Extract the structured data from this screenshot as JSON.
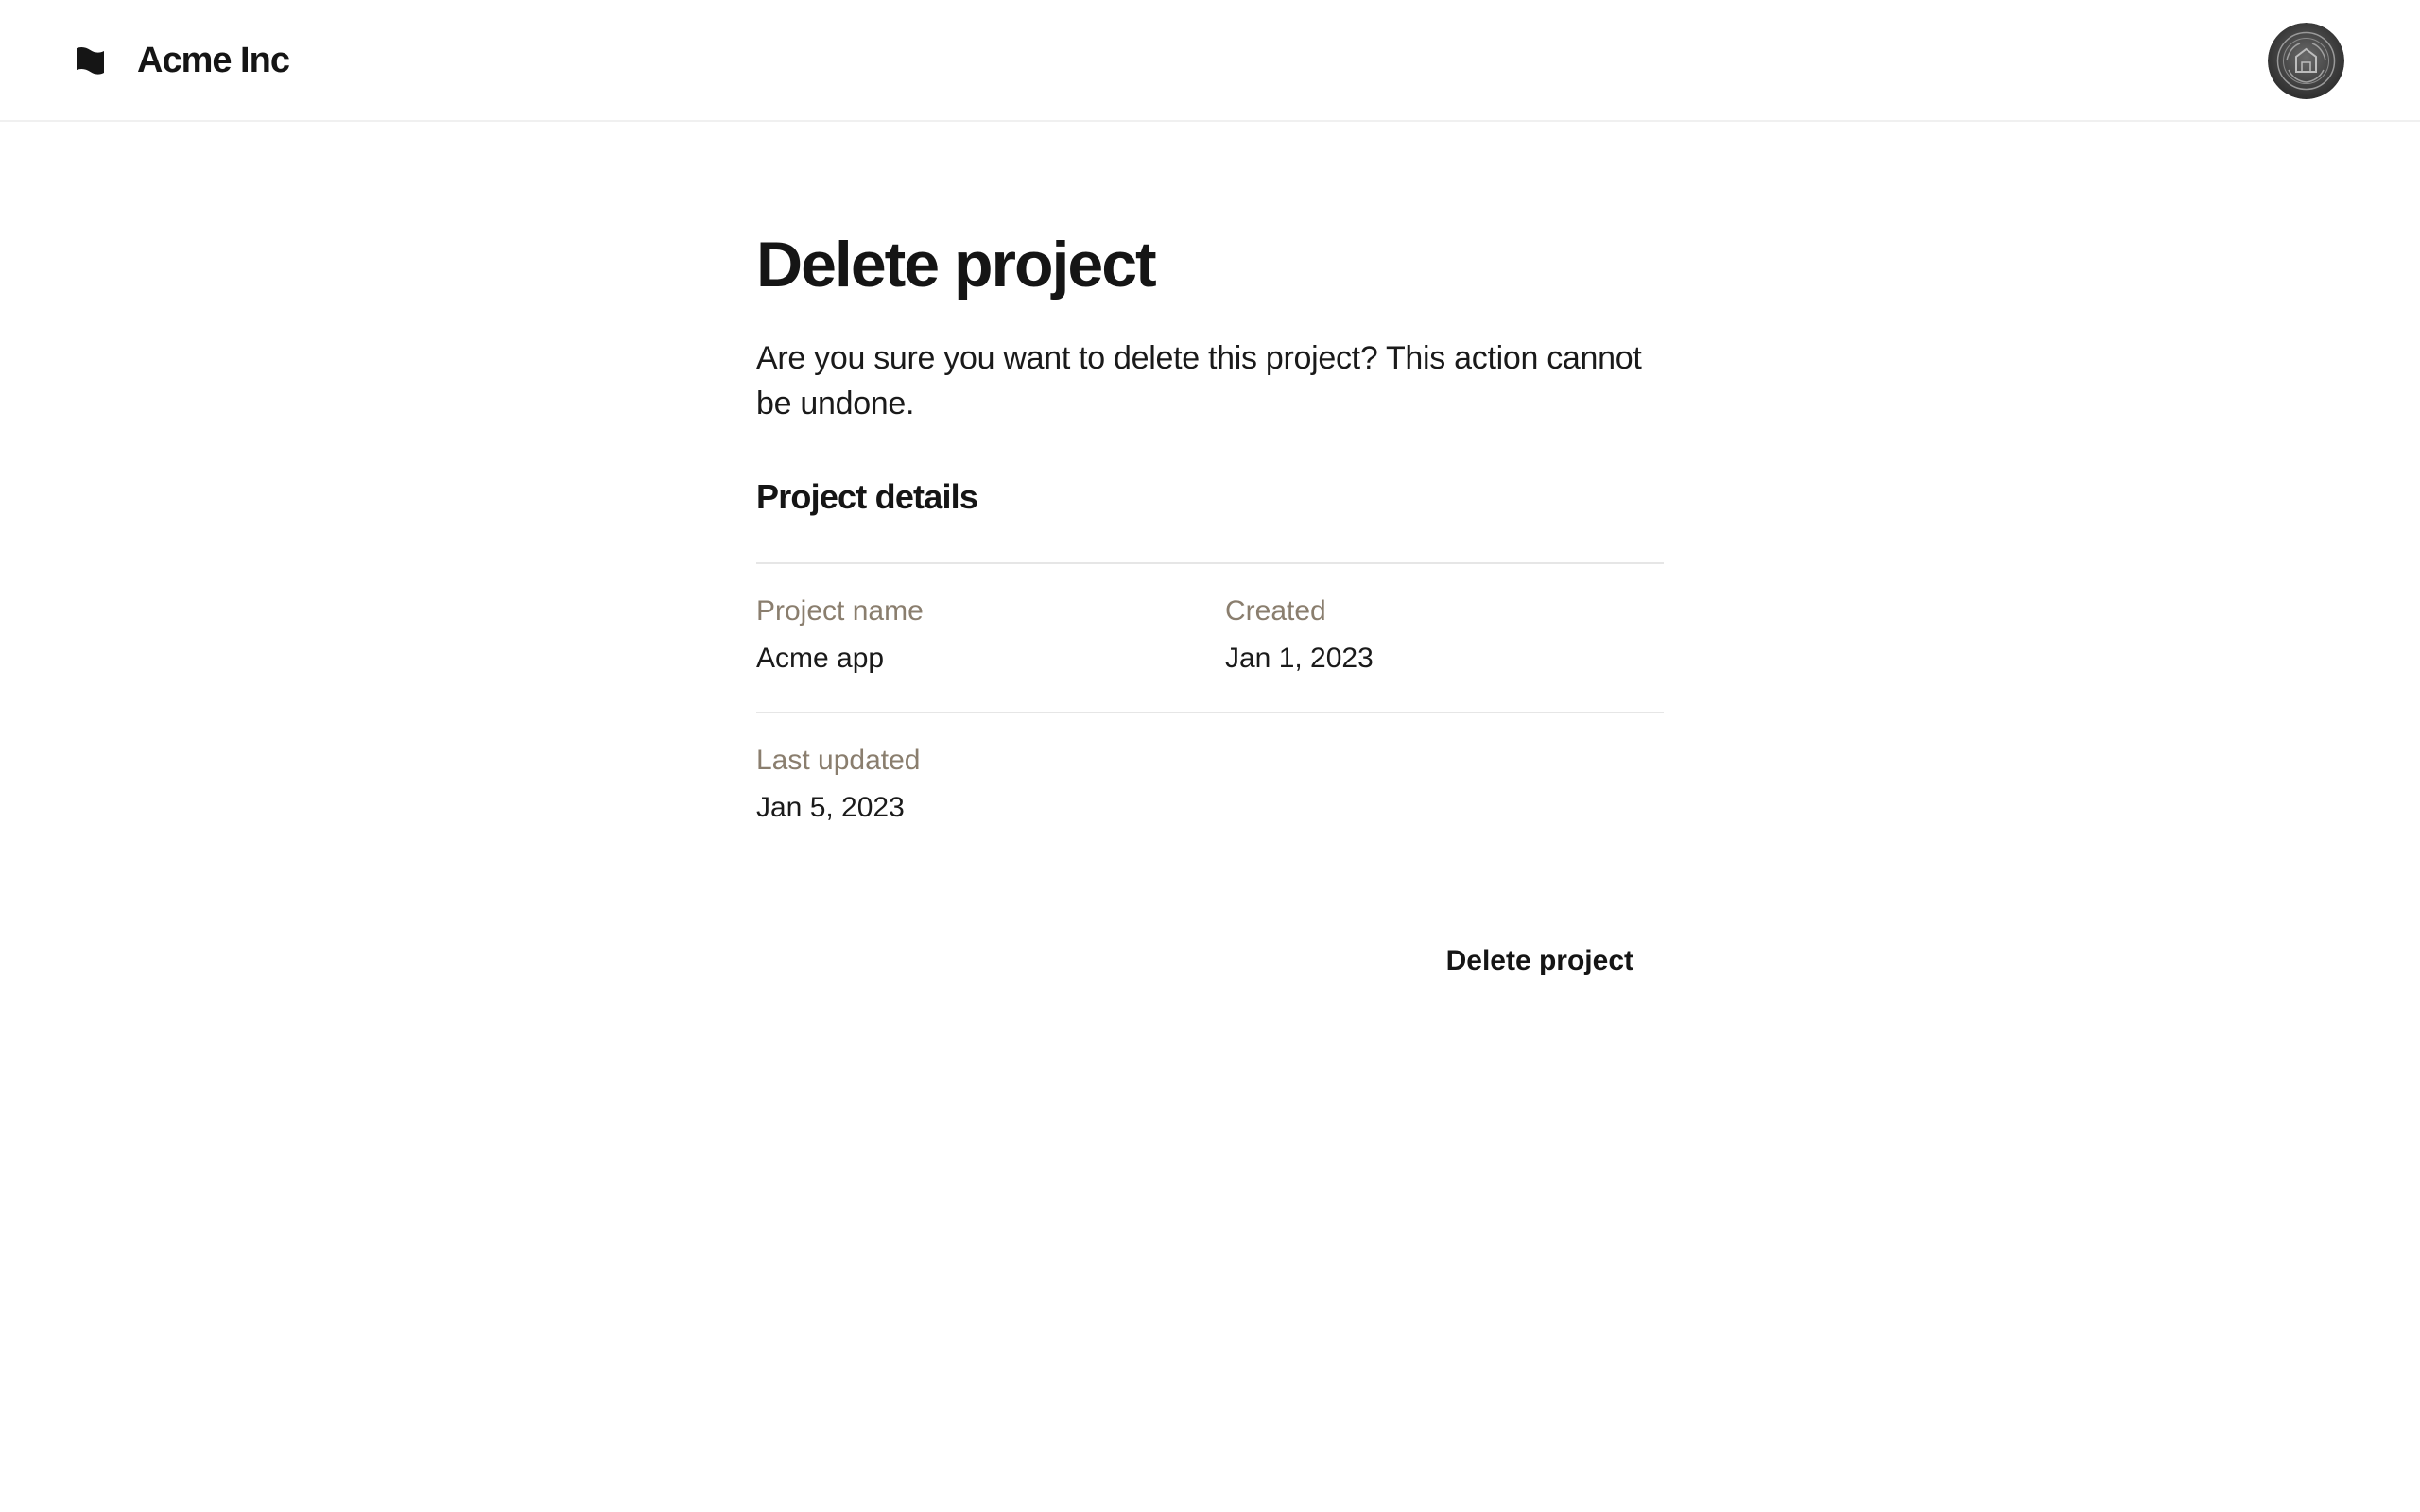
{
  "header": {
    "brand_icon": "flag-icon",
    "brand_name": "Acme Inc",
    "avatar_icon": "user-avatar"
  },
  "main": {
    "title": "Delete project",
    "description": "Are you sure you want to delete this project? This action cannot be undone.",
    "section_title": "Project details",
    "details": [
      {
        "label": "Project name",
        "value": "Acme app"
      },
      {
        "label": "Created",
        "value": "Jan 1, 2023"
      },
      {
        "label": "Last updated",
        "value": "Jan 5, 2023"
      }
    ],
    "delete_button_label": "Delete project"
  },
  "colors": {
    "text": "#151515",
    "label": "#8a7e6e",
    "divider": "#e6e6e6"
  }
}
